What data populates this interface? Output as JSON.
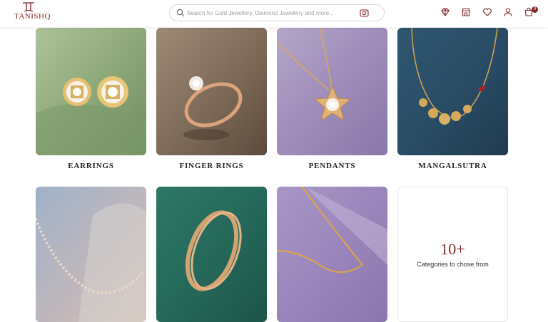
{
  "brand": {
    "name": "TANISHQ",
    "color": "#832729"
  },
  "search": {
    "placeholder": "Search for Gold Jewellery, Diamond Jewellery and more..."
  },
  "header_icons": [
    "diamond-icon",
    "store-icon",
    "heart-icon",
    "user-icon",
    "cart-icon"
  ],
  "cart": {
    "count": "0"
  },
  "categories": [
    {
      "label": "EARRINGS"
    },
    {
      "label": "FINGER RINGS"
    },
    {
      "label": "PENDANTS"
    },
    {
      "label": "MANGALSUTRA"
    }
  ],
  "more": {
    "count": "10+",
    "caption": "Categories to chose from"
  }
}
